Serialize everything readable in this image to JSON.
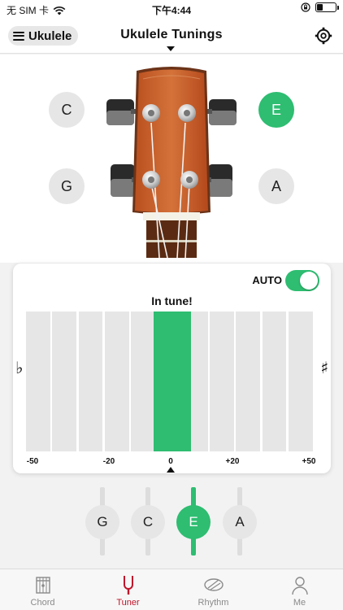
{
  "status_bar": {
    "carrier": "无 SIM 卡",
    "time": "下午4:44",
    "battery_level": 0.3
  },
  "header": {
    "instrument": "Ukulele",
    "title": "Ukulele Tunings"
  },
  "headstock": {
    "strings": [
      {
        "note": "C",
        "active": false
      },
      {
        "note": "G",
        "active": false
      },
      {
        "note": "E",
        "active": true
      },
      {
        "note": "A",
        "active": false
      }
    ]
  },
  "tuner": {
    "auto_label": "AUTO",
    "auto_enabled": true,
    "status": "In tune!",
    "flat_symbol": "♭",
    "sharp_symbol": "♯",
    "scale": [
      "-50",
      "-20",
      "0",
      "+20",
      "+50"
    ],
    "cents_offset": 0
  },
  "string_selector": [
    {
      "note": "G",
      "active": false
    },
    {
      "note": "C",
      "active": false
    },
    {
      "note": "E",
      "active": true
    },
    {
      "note": "A",
      "active": false
    }
  ],
  "tabs": [
    {
      "label": "Chord",
      "icon": "chord-icon",
      "active": false
    },
    {
      "label": "Tuner",
      "icon": "tuning-fork-icon",
      "active": true
    },
    {
      "label": "Rhythm",
      "icon": "drum-icon",
      "active": false
    },
    {
      "label": "Me",
      "icon": "person-icon",
      "active": false
    }
  ],
  "colors": {
    "accent": "#2ebd71",
    "active_tab": "#c0142b",
    "inactive": "#e6e6e6"
  }
}
